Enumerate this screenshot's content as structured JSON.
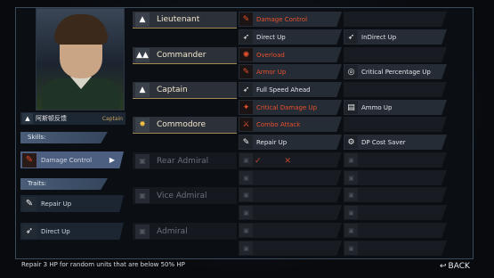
{
  "officer": {
    "name": "阿斯顿反馈",
    "tag": "Captain",
    "rank_icon": "rank-insignia-icon"
  },
  "sections": {
    "skills": "Skills:",
    "traits": "Traits:"
  },
  "skills": [
    {
      "label": "Damage Control",
      "icon": "wrench-icon"
    }
  ],
  "traits": [
    {
      "label": "Repair Up",
      "icon": "wrench-icon"
    },
    {
      "label": "Direct Up",
      "icon": "missile-icon"
    }
  ],
  "ranks": [
    {
      "label": "Lieutenant",
      "icon": "one-chevron-icon",
      "locked": false
    },
    {
      "label": "Commander",
      "icon": "two-chevron-icon",
      "locked": false
    },
    {
      "label": "Captain",
      "icon": "three-chevron-icon",
      "locked": false
    },
    {
      "label": "Commodore",
      "icon": "star-burst-icon",
      "locked": false
    },
    {
      "label": "Rear Admiral",
      "icon": "lock-icon",
      "locked": true
    },
    {
      "label": "Vice Admiral",
      "icon": "lock-icon",
      "locked": true
    },
    {
      "label": "Admiral",
      "icon": "lock-icon",
      "locked": true
    }
  ],
  "grid_left": [
    {
      "label": "Damage Control",
      "icon": "wrench-icon",
      "style": "red"
    },
    {
      "label": "Direct Up",
      "icon": "missile-icon",
      "style": "white"
    },
    {
      "label": "Overload",
      "icon": "burst-icon",
      "style": "red"
    },
    {
      "label": "Armor Up",
      "icon": "wrench-icon",
      "style": "red"
    },
    {
      "label": "Full Speed Ahead",
      "icon": "missile-icon",
      "style": "white"
    },
    {
      "label": "Critical Damage Up",
      "icon": "star-icon",
      "style": "red"
    },
    {
      "label": "Combo Attack",
      "icon": "swords-icon",
      "style": "red"
    },
    {
      "label": "Repair Up",
      "icon": "wrench-icon",
      "style": "white"
    }
  ],
  "grid_right": [
    {
      "label": "",
      "icon": "",
      "style": "empty"
    },
    {
      "label": "InDirect Up",
      "icon": "missile-icon",
      "style": "white"
    },
    {
      "label": "",
      "icon": "",
      "style": "empty"
    },
    {
      "label": "Critical Percentage Up",
      "icon": "target-icon",
      "style": "white"
    },
    {
      "label": "",
      "icon": "",
      "style": "empty"
    },
    {
      "label": "Ammo Up",
      "icon": "ammo-icon",
      "style": "white"
    },
    {
      "label": "",
      "icon": "",
      "style": "empty"
    },
    {
      "label": "DP Cost Saver",
      "icon": "gear-icon",
      "style": "white"
    }
  ],
  "description": "Repair 3 HP for random units that are below 50% HP",
  "back_label": "BACK"
}
